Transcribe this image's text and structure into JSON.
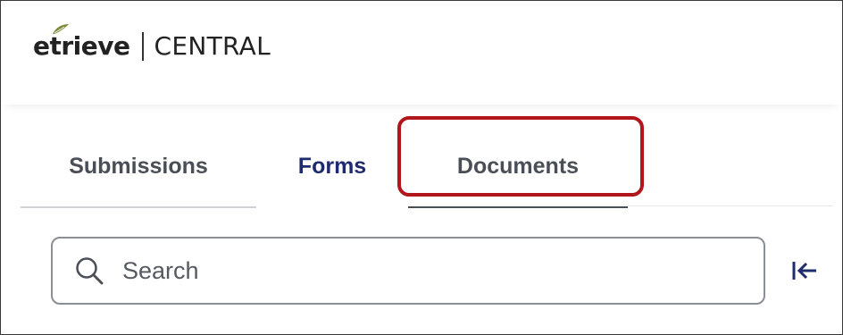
{
  "brand": {
    "logo_text": "etrieve",
    "product_name": "CENTRAL"
  },
  "tabs": [
    {
      "label": "Submissions",
      "state": "inactive"
    },
    {
      "label": "Forms",
      "state": "inactive"
    },
    {
      "label": "Documents",
      "state": "active"
    }
  ],
  "search": {
    "placeholder": "Search",
    "value": "",
    "icon": "search-icon"
  },
  "toolbar": {
    "collapse_icon": "collapse-left-icon"
  },
  "colors": {
    "highlight_border": "#b0161c",
    "forms_tab_text": "#1f2b6e",
    "tab_text": "#4a4f57",
    "leaf_accent": "#7a8a3a"
  }
}
